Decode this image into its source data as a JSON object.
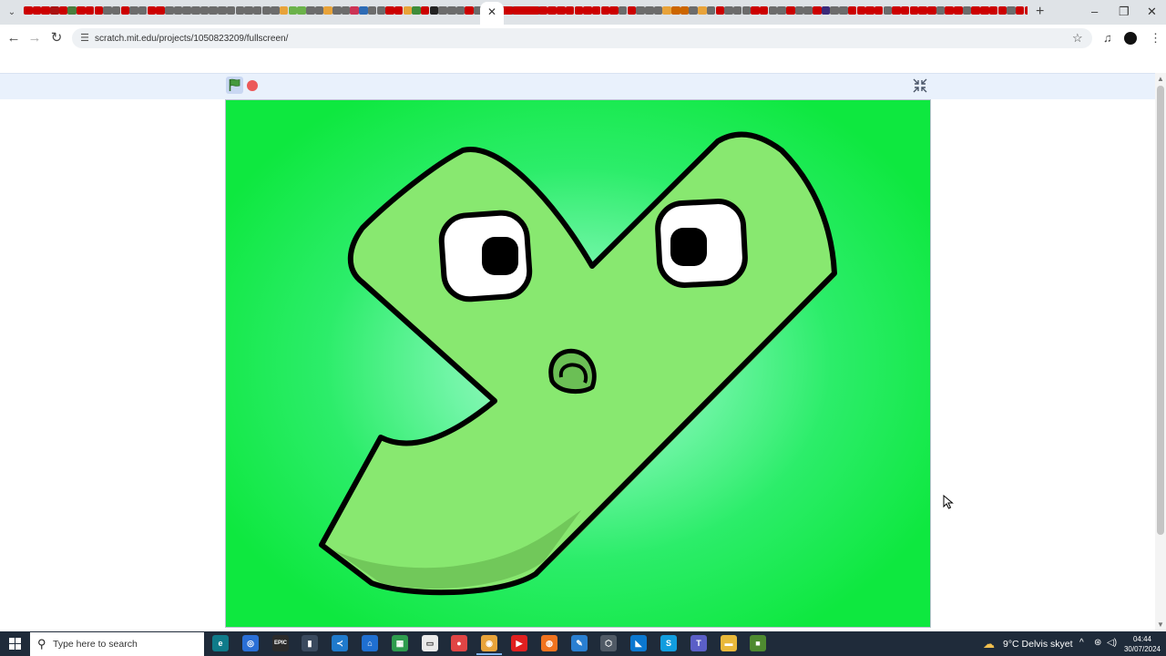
{
  "browser": {
    "tab_favicon_colors": [
      "#cc0000",
      "#cc0000",
      "#cc0000",
      "#aa1111",
      "#cc0000",
      "#4a7d3e",
      "#cc0000",
      "#cc0000",
      "#cc0000",
      "#6c6c6c",
      "#6c6c6c",
      "#cc0000",
      "#6c6c6c",
      "#6c6c6c",
      "#cc0000",
      "#cc0000",
      "#6c6c6c",
      "#6c6c6c",
      "#6c6c6c",
      "#6c6c6c",
      "#6c6c6c",
      "#6c6c6c",
      "#6c6c6c",
      "#6c6c6c",
      "#6c6c6c",
      "#6c6c6c",
      "#6c6c6c",
      "#6c6c6c",
      "#6c6c6c",
      "#e8a33a",
      "#6bb24a",
      "#6bb24a",
      "#6c6c6c",
      "#6c6c6c",
      "#e8a33a",
      "#6c6c6c",
      "#6c6c6c",
      "#cc3355",
      "#2d6bb5",
      "#6c6c6c",
      "#6c6c6c",
      "#cc0000",
      "#cc0000",
      "#e8a33a",
      "#3f8c3a",
      "#cc0000",
      "#222222",
      "#6c6c6c",
      "#6c6c6c",
      "#6c6c6c",
      "#cc0000",
      "#6c6c6c",
      "#6c6c6c",
      "#6c6c6c",
      "#cc0000",
      "#6c6c6c",
      "#cc0000",
      "#cc0000",
      "#6c6c6c"
    ],
    "tab_favicon_colors_right": [
      "#cc0000",
      "#cc0000",
      "#cc0000",
      "#cc0000",
      "#cc0000",
      "#cc0000",
      "#cc0000",
      "#cc0000",
      "#cc0000",
      "#cc0000",
      "#cc0000",
      "#cc0000",
      "#cc0000",
      "#6c6c6c",
      "#cc0000",
      "#6c6c6c",
      "#6c6c6c",
      "#6c6c6c",
      "#e8a33a",
      "#cc6600",
      "#cc6600",
      "#6c6c6c",
      "#e8a33a",
      "#6c6c6c",
      "#cc0000",
      "#6c6c6c",
      "#6c6c6c",
      "#6c6c6c",
      "#cc0000",
      "#cc0000",
      "#6c6c6c",
      "#6c6c6c",
      "#cc0000",
      "#6c6c6c",
      "#6c6c6c",
      "#cc0000",
      "#3a2a7a",
      "#6c6c6c",
      "#6c6c6c",
      "#cc0000",
      "#cc0000",
      "#cc0000",
      "#cc0000",
      "#6c6c6c",
      "#cc0000",
      "#cc0000",
      "#cc0000",
      "#cc0000",
      "#cc0000",
      "#6c6c6c",
      "#cc0000",
      "#cc0000",
      "#6c6c6c",
      "#cc0000",
      "#cc0000",
      "#cc0000",
      "#cc0000",
      "#6c6c6c",
      "#cc0000",
      "#cc0000",
      "#6c6c6c",
      "#e8a33a",
      "#cc0000",
      "#cc0000"
    ],
    "active_tab_close_glyph": "✕",
    "new_tab_glyph": "+",
    "window_controls": {
      "minimize": "–",
      "restore": "❐",
      "close": "✕"
    },
    "url": "scratch.mit.edu/projects/1050823209/fullscreen/"
  },
  "scratch": {
    "stage_background_colors": [
      "#0ee83f",
      "#b7f7d1"
    ],
    "letter_color": "#88e870",
    "letter_shadow_color": "#6bbf55",
    "flag_color": "#45993d",
    "stop_color": "#ec5959"
  },
  "taskbar": {
    "search_placeholder": "Type here to search",
    "apps": [
      {
        "icon": "edge-icon",
        "color": "#0f7b8a",
        "glyph": "e"
      },
      {
        "icon": "browser-blue-icon",
        "color": "#2a6fd6",
        "glyph": "◎"
      },
      {
        "icon": "epic-games-icon",
        "color": "#2b2b2b",
        "glyph": "EPIC"
      },
      {
        "icon": "file-icon",
        "color": "#3a4a5e",
        "glyph": "▮"
      },
      {
        "icon": "vscode-icon",
        "color": "#1f7acc",
        "glyph": "≺"
      },
      {
        "icon": "store-icon",
        "color": "#1f6fd0",
        "glyph": "⌂"
      },
      {
        "icon": "office-icon",
        "color": "#2e9c4e",
        "glyph": "▦"
      },
      {
        "icon": "notepad-icon",
        "color": "#eaeaea",
        "glyph": "▭"
      },
      {
        "icon": "recorder-icon",
        "color": "#e04545",
        "glyph": "●"
      },
      {
        "icon": "chrome-icon",
        "color": "#e8a33a",
        "glyph": "◉"
      },
      {
        "icon": "youtube-icon",
        "color": "#e02020",
        "glyph": "▶"
      },
      {
        "icon": "firefox-icon",
        "color": "#f0731f",
        "glyph": "◍"
      },
      {
        "icon": "paint-icon",
        "color": "#2a7fd1",
        "glyph": "✎"
      },
      {
        "icon": "3d-viewer-icon",
        "color": "#505a66",
        "glyph": "⬡"
      },
      {
        "icon": "editor-icon",
        "color": "#0b78d0",
        "glyph": "◣"
      },
      {
        "icon": "skype-icon",
        "color": "#119ddf",
        "glyph": "S"
      },
      {
        "icon": "teams-icon",
        "color": "#5b5fc7",
        "glyph": "T"
      },
      {
        "icon": "explorer-icon",
        "color": "#e9b83a",
        "glyph": "▬"
      },
      {
        "icon": "minecraft-icon",
        "color": "#4e8a30",
        "glyph": "■"
      }
    ],
    "weather_icon": "☁",
    "weather": "9°C  Delvis skyet",
    "tray": {
      "chevron": "^",
      "network": "⊛",
      "volume": "◁)"
    },
    "time": "04:44",
    "date": "30/07/2024"
  }
}
